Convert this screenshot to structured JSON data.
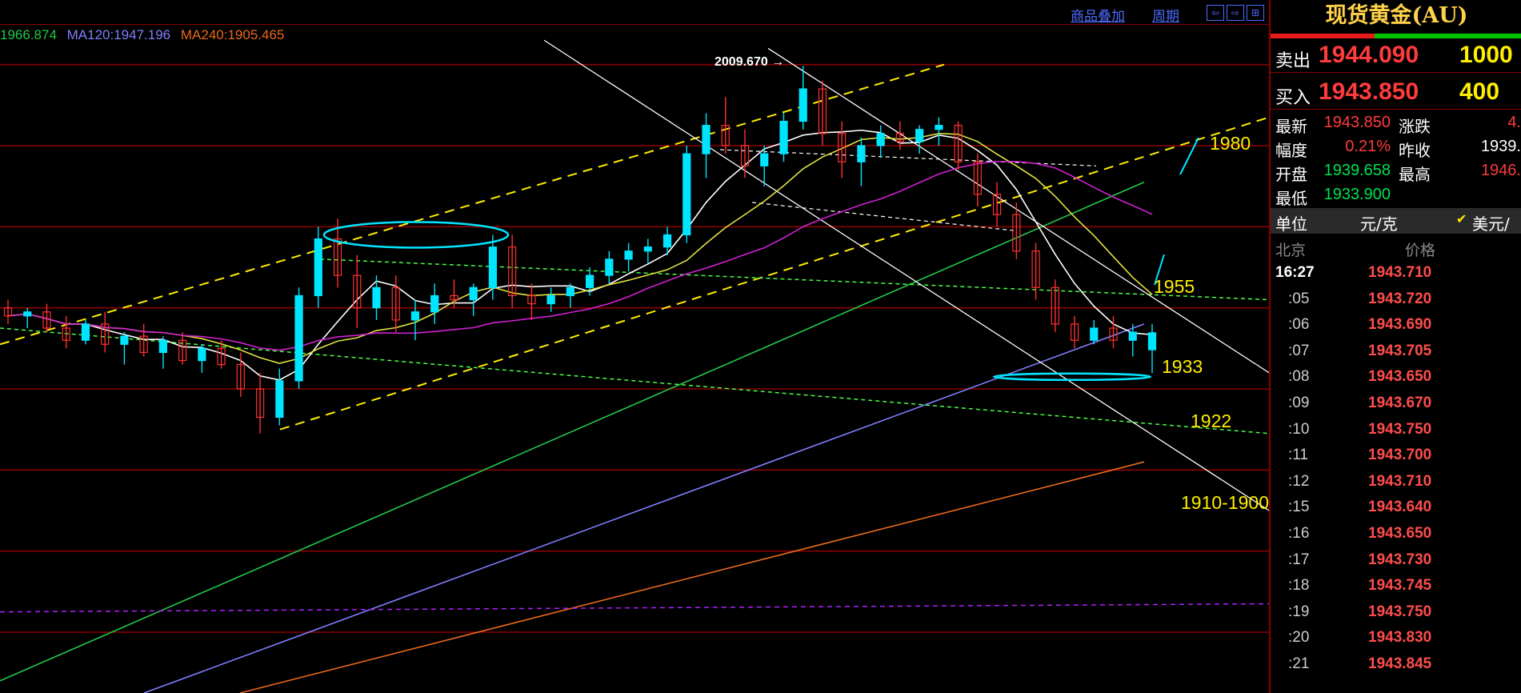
{
  "toolbar": {
    "overlay_label": "商品叠加",
    "period_label": "周期",
    "nav_buttons": [
      "⇦",
      "⇨",
      "⊞"
    ]
  },
  "ma_legend": [
    {
      "text": "1966.874",
      "color": "#22c94a"
    },
    {
      "text": "MA120:1947.196",
      "color": "#7f7fff"
    },
    {
      "text": "MA240:1905.465",
      "color": "#e86a1c"
    }
  ],
  "annotations": {
    "peak_label": "2009.670",
    "levels": [
      {
        "text": "1980",
        "color": "#ffee00"
      },
      {
        "text": "1955",
        "color": "#ffee00"
      },
      {
        "text": "1933",
        "color": "#ffee00"
      },
      {
        "text": "1922",
        "color": "#ffee00"
      },
      {
        "text": "1910-1900",
        "color": "#ffee00"
      }
    ]
  },
  "colors": {
    "bull": "#00e5ff",
    "bear": "#ff3030",
    "ma_short": "#ffffff",
    "ma_10": "#e0e040",
    "ma_20": "#d020d0",
    "ma_60": "#22c94a",
    "ma_120": "#7f7fff",
    "ma_240": "#e86a1c",
    "channel": "#ffee00",
    "trend": "#ffffff",
    "support_dash": "#44ff44",
    "horizontal_dash": "#b020ff",
    "grid": "#8a0000",
    "ellipse": "#00e5ff"
  },
  "side_panel": {
    "title": "现货黄金(AU)",
    "sell": {
      "label": "卖出",
      "price": "1944.090",
      "volume": "1000"
    },
    "buy": {
      "label": "买入",
      "price": "1943.850",
      "volume": "400"
    },
    "stats": [
      {
        "label": "最新",
        "value": "1943.850",
        "value_color": "#ff3b3b"
      },
      {
        "label": "涨跌",
        "value": "4.",
        "value_color": "#ff3b3b"
      },
      {
        "label": "幅度",
        "value": "0.21%",
        "value_color": "#ff3b3b"
      },
      {
        "label": "昨收",
        "value": "1939.",
        "value_color": "#ffffff"
      },
      {
        "label": "开盘",
        "value": "1939.658",
        "value_color": "#00e050"
      },
      {
        "label": "最高",
        "value": "1946.",
        "value_color": "#ff3b3b"
      },
      {
        "label": "最低",
        "value": "1933.900",
        "value_color": "#00e050"
      }
    ],
    "unit_label": "单位",
    "unit_value": "元/克",
    "currency_check": "✔",
    "currency_label": "美元/",
    "ticks_header": {
      "city": "北京",
      "price": "价格"
    },
    "ticks": [
      {
        "time": "16:27",
        "price": "1943.710"
      },
      {
        "time": ":05",
        "price": "1943.720"
      },
      {
        "time": ":06",
        "price": "1943.690"
      },
      {
        "time": ":07",
        "price": "1943.705"
      },
      {
        "time": ":08",
        "price": "1943.650"
      },
      {
        "time": ":09",
        "price": "1943.670"
      },
      {
        "time": ":10",
        "price": "1943.750"
      },
      {
        "time": ":11",
        "price": "1943.700"
      },
      {
        "time": ":12",
        "price": "1943.710"
      },
      {
        "time": ":15",
        "price": "1943.640"
      },
      {
        "time": ":16",
        "price": "1943.650"
      },
      {
        "time": ":17",
        "price": "1943.730"
      },
      {
        "time": ":18",
        "price": "1943.745"
      },
      {
        "time": ":19",
        "price": "1943.750"
      },
      {
        "time": ":20",
        "price": "1943.830"
      },
      {
        "time": ":21",
        "price": "1943.845"
      }
    ]
  },
  "chart_data": {
    "type": "candlestick",
    "title": "",
    "ylim": [
      1855,
      2020
    ],
    "candles": [
      {
        "o": 1950,
        "h": 1952,
        "l": 1946,
        "c": 1948
      },
      {
        "o": 1948,
        "h": 1950,
        "l": 1945,
        "c": 1949
      },
      {
        "o": 1949,
        "h": 1951,
        "l": 1944,
        "c": 1945
      },
      {
        "o": 1945,
        "h": 1948,
        "l": 1940,
        "c": 1942
      },
      {
        "o": 1942,
        "h": 1947,
        "l": 1941,
        "c": 1946
      },
      {
        "o": 1946,
        "h": 1949,
        "l": 1939,
        "c": 1941
      },
      {
        "o": 1941,
        "h": 1944,
        "l": 1936,
        "c": 1943
      },
      {
        "o": 1943,
        "h": 1946,
        "l": 1938,
        "c": 1939
      },
      {
        "o": 1939,
        "h": 1943,
        "l": 1935,
        "c": 1942
      },
      {
        "o": 1942,
        "h": 1944,
        "l": 1936,
        "c": 1937
      },
      {
        "o": 1937,
        "h": 1941,
        "l": 1934,
        "c": 1940
      },
      {
        "o": 1940,
        "h": 1942,
        "l": 1935,
        "c": 1936
      },
      {
        "o": 1936,
        "h": 1939,
        "l": 1928,
        "c": 1930
      },
      {
        "o": 1930,
        "h": 1934,
        "l": 1919,
        "c": 1923
      },
      {
        "o": 1923,
        "h": 1935,
        "l": 1921,
        "c": 1932
      },
      {
        "o": 1932,
        "h": 1955,
        "l": 1930,
        "c": 1953
      },
      {
        "o": 1953,
        "h": 1970,
        "l": 1950,
        "c": 1967
      },
      {
        "o": 1967,
        "h": 1972,
        "l": 1955,
        "c": 1958
      },
      {
        "o": 1958,
        "h": 1963,
        "l": 1945,
        "c": 1950
      },
      {
        "o": 1950,
        "h": 1958,
        "l": 1947,
        "c": 1955
      },
      {
        "o": 1955,
        "h": 1958,
        "l": 1944,
        "c": 1947
      },
      {
        "o": 1947,
        "h": 1952,
        "l": 1942,
        "c": 1949
      },
      {
        "o": 1949,
        "h": 1956,
        "l": 1946,
        "c": 1953
      },
      {
        "o": 1953,
        "h": 1957,
        "l": 1950,
        "c": 1952
      },
      {
        "o": 1952,
        "h": 1956,
        "l": 1948,
        "c": 1955
      },
      {
        "o": 1955,
        "h": 1968,
        "l": 1952,
        "c": 1965
      },
      {
        "o": 1965,
        "h": 1968,
        "l": 1950,
        "c": 1953
      },
      {
        "o": 1953,
        "h": 1956,
        "l": 1947,
        "c": 1951
      },
      {
        "o": 1951,
        "h": 1955,
        "l": 1949,
        "c": 1953
      },
      {
        "o": 1953,
        "h": 1956,
        "l": 1950,
        "c": 1955
      },
      {
        "o": 1955,
        "h": 1960,
        "l": 1953,
        "c": 1958
      },
      {
        "o": 1958,
        "h": 1964,
        "l": 1956,
        "c": 1962
      },
      {
        "o": 1962,
        "h": 1966,
        "l": 1959,
        "c": 1964
      },
      {
        "o": 1964,
        "h": 1967,
        "l": 1961,
        "c": 1965
      },
      {
        "o": 1965,
        "h": 1970,
        "l": 1963,
        "c": 1968
      },
      {
        "o": 1968,
        "h": 1990,
        "l": 1966,
        "c": 1988
      },
      {
        "o": 1988,
        "h": 1998,
        "l": 1982,
        "c": 1995
      },
      {
        "o": 1995,
        "h": 2002,
        "l": 1988,
        "c": 1990
      },
      {
        "o": 1990,
        "h": 1994,
        "l": 1982,
        "c": 1985
      },
      {
        "o": 1985,
        "h": 1990,
        "l": 1980,
        "c": 1988
      },
      {
        "o": 1988,
        "h": 1998,
        "l": 1986,
        "c": 1996
      },
      {
        "o": 1996,
        "h": 2009.67,
        "l": 1994,
        "c": 2004
      },
      {
        "o": 2004,
        "h": 2006,
        "l": 1990,
        "c": 1993
      },
      {
        "o": 1993,
        "h": 1996,
        "l": 1982,
        "c": 1986
      },
      {
        "o": 1986,
        "h": 1992,
        "l": 1980,
        "c": 1990
      },
      {
        "o": 1990,
        "h": 1995,
        "l": 1987,
        "c": 1993
      },
      {
        "o": 1993,
        "h": 1996,
        "l": 1989,
        "c": 1991
      },
      {
        "o": 1991,
        "h": 1995,
        "l": 1988,
        "c": 1994
      },
      {
        "o": 1994,
        "h": 1997,
        "l": 1990,
        "c": 1995
      },
      {
        "o": 1995,
        "h": 1996,
        "l": 1984,
        "c": 1986
      },
      {
        "o": 1986,
        "h": 1988,
        "l": 1975,
        "c": 1978
      },
      {
        "o": 1978,
        "h": 1981,
        "l": 1970,
        "c": 1973
      },
      {
        "o": 1973,
        "h": 1976,
        "l": 1962,
        "c": 1964
      },
      {
        "o": 1964,
        "h": 1966,
        "l": 1952,
        "c": 1955
      },
      {
        "o": 1955,
        "h": 1957,
        "l": 1944,
        "c": 1946
      },
      {
        "o": 1946,
        "h": 1948,
        "l": 1940,
        "c": 1942
      },
      {
        "o": 1942,
        "h": 1947,
        "l": 1941,
        "c": 1945
      },
      {
        "o": 1945,
        "h": 1948,
        "l": 1940,
        "c": 1942
      },
      {
        "o": 1942,
        "h": 1946,
        "l": 1938,
        "c": 1944
      },
      {
        "o": 1939.658,
        "h": 1946,
        "l": 1933.9,
        "c": 1943.85
      }
    ],
    "levels": [
      1980,
      1955,
      1933,
      1922,
      1910,
      1900
    ],
    "peak": 2009.67
  }
}
